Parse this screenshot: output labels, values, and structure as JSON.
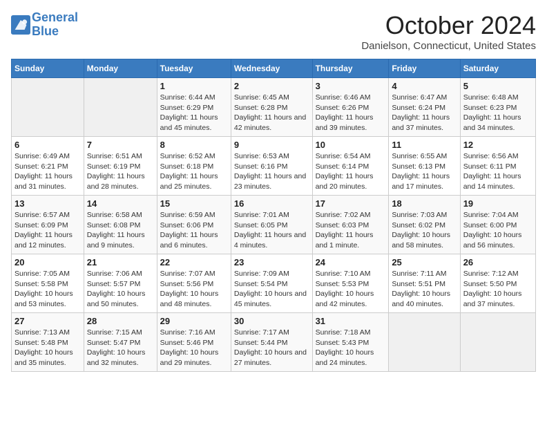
{
  "header": {
    "logo_line1": "General",
    "logo_line2": "Blue",
    "month_title": "October 2024",
    "location": "Danielson, Connecticut, United States"
  },
  "days_of_week": [
    "Sunday",
    "Monday",
    "Tuesday",
    "Wednesday",
    "Thursday",
    "Friday",
    "Saturday"
  ],
  "weeks": [
    [
      {
        "day": "",
        "info": ""
      },
      {
        "day": "",
        "info": ""
      },
      {
        "day": "1",
        "info": "Sunrise: 6:44 AM\nSunset: 6:29 PM\nDaylight: 11 hours and 45 minutes."
      },
      {
        "day": "2",
        "info": "Sunrise: 6:45 AM\nSunset: 6:28 PM\nDaylight: 11 hours and 42 minutes."
      },
      {
        "day": "3",
        "info": "Sunrise: 6:46 AM\nSunset: 6:26 PM\nDaylight: 11 hours and 39 minutes."
      },
      {
        "day": "4",
        "info": "Sunrise: 6:47 AM\nSunset: 6:24 PM\nDaylight: 11 hours and 37 minutes."
      },
      {
        "day": "5",
        "info": "Sunrise: 6:48 AM\nSunset: 6:23 PM\nDaylight: 11 hours and 34 minutes."
      }
    ],
    [
      {
        "day": "6",
        "info": "Sunrise: 6:49 AM\nSunset: 6:21 PM\nDaylight: 11 hours and 31 minutes."
      },
      {
        "day": "7",
        "info": "Sunrise: 6:51 AM\nSunset: 6:19 PM\nDaylight: 11 hours and 28 minutes."
      },
      {
        "day": "8",
        "info": "Sunrise: 6:52 AM\nSunset: 6:18 PM\nDaylight: 11 hours and 25 minutes."
      },
      {
        "day": "9",
        "info": "Sunrise: 6:53 AM\nSunset: 6:16 PM\nDaylight: 11 hours and 23 minutes."
      },
      {
        "day": "10",
        "info": "Sunrise: 6:54 AM\nSunset: 6:14 PM\nDaylight: 11 hours and 20 minutes."
      },
      {
        "day": "11",
        "info": "Sunrise: 6:55 AM\nSunset: 6:13 PM\nDaylight: 11 hours and 17 minutes."
      },
      {
        "day": "12",
        "info": "Sunrise: 6:56 AM\nSunset: 6:11 PM\nDaylight: 11 hours and 14 minutes."
      }
    ],
    [
      {
        "day": "13",
        "info": "Sunrise: 6:57 AM\nSunset: 6:09 PM\nDaylight: 11 hours and 12 minutes."
      },
      {
        "day": "14",
        "info": "Sunrise: 6:58 AM\nSunset: 6:08 PM\nDaylight: 11 hours and 9 minutes."
      },
      {
        "day": "15",
        "info": "Sunrise: 6:59 AM\nSunset: 6:06 PM\nDaylight: 11 hours and 6 minutes."
      },
      {
        "day": "16",
        "info": "Sunrise: 7:01 AM\nSunset: 6:05 PM\nDaylight: 11 hours and 4 minutes."
      },
      {
        "day": "17",
        "info": "Sunrise: 7:02 AM\nSunset: 6:03 PM\nDaylight: 11 hours and 1 minute."
      },
      {
        "day": "18",
        "info": "Sunrise: 7:03 AM\nSunset: 6:02 PM\nDaylight: 10 hours and 58 minutes."
      },
      {
        "day": "19",
        "info": "Sunrise: 7:04 AM\nSunset: 6:00 PM\nDaylight: 10 hours and 56 minutes."
      }
    ],
    [
      {
        "day": "20",
        "info": "Sunrise: 7:05 AM\nSunset: 5:58 PM\nDaylight: 10 hours and 53 minutes."
      },
      {
        "day": "21",
        "info": "Sunrise: 7:06 AM\nSunset: 5:57 PM\nDaylight: 10 hours and 50 minutes."
      },
      {
        "day": "22",
        "info": "Sunrise: 7:07 AM\nSunset: 5:56 PM\nDaylight: 10 hours and 48 minutes."
      },
      {
        "day": "23",
        "info": "Sunrise: 7:09 AM\nSunset: 5:54 PM\nDaylight: 10 hours and 45 minutes."
      },
      {
        "day": "24",
        "info": "Sunrise: 7:10 AM\nSunset: 5:53 PM\nDaylight: 10 hours and 42 minutes."
      },
      {
        "day": "25",
        "info": "Sunrise: 7:11 AM\nSunset: 5:51 PM\nDaylight: 10 hours and 40 minutes."
      },
      {
        "day": "26",
        "info": "Sunrise: 7:12 AM\nSunset: 5:50 PM\nDaylight: 10 hours and 37 minutes."
      }
    ],
    [
      {
        "day": "27",
        "info": "Sunrise: 7:13 AM\nSunset: 5:48 PM\nDaylight: 10 hours and 35 minutes."
      },
      {
        "day": "28",
        "info": "Sunrise: 7:15 AM\nSunset: 5:47 PM\nDaylight: 10 hours and 32 minutes."
      },
      {
        "day": "29",
        "info": "Sunrise: 7:16 AM\nSunset: 5:46 PM\nDaylight: 10 hours and 29 minutes."
      },
      {
        "day": "30",
        "info": "Sunrise: 7:17 AM\nSunset: 5:44 PM\nDaylight: 10 hours and 27 minutes."
      },
      {
        "day": "31",
        "info": "Sunrise: 7:18 AM\nSunset: 5:43 PM\nDaylight: 10 hours and 24 minutes."
      },
      {
        "day": "",
        "info": ""
      },
      {
        "day": "",
        "info": ""
      }
    ]
  ]
}
